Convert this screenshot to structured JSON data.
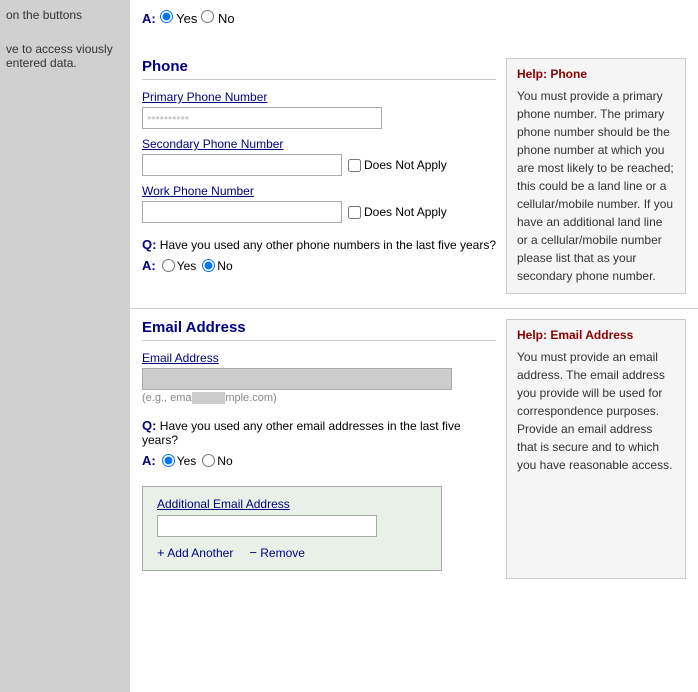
{
  "sidebar": {
    "top_text": "on the buttons",
    "bottom_text": "ve to access viously entered data."
  },
  "phone_section": {
    "title": "Phone",
    "primary_label": "Primary Phone Number",
    "secondary_label": "Secondary Phone Number",
    "work_label": "Work Phone Number",
    "does_not_apply": "Does Not Apply",
    "help_title": "Help: Phone",
    "help_text": "You must provide a primary phone number. The primary phone number should be the phone number at which you are most likely to be reached; this could be a land line or a cellular/mobile number. If you have an additional land line or a cellular/mobile number please list that as your secondary phone number.",
    "question": "Have you used any other phone numbers in the last five years?",
    "q_label": "Q:",
    "a_label": "A:",
    "yes_label": "Yes",
    "no_label": "No",
    "answer": "no"
  },
  "email_section": {
    "title": "Email Address",
    "email_label": "Email Address",
    "placeholder": "(e.g., email@example.com)",
    "help_title": "Help: Email Address",
    "help_text": "You must provide an email address. The email address you provide will be used for correspondence purposes. Provide an email address that is secure and to which you have reasonable access.",
    "question": "Have you used any other email addresses in the last five years?",
    "q_label": "Q:",
    "a_label": "A:",
    "yes_label": "Yes",
    "no_label": "No",
    "answer": "yes",
    "additional_email_label": "Additional Email Address",
    "add_another": "Add Another",
    "remove": "Remove"
  },
  "top_answer": {
    "a_label": "A:",
    "yes_label": "Yes",
    "no_label": "No"
  }
}
